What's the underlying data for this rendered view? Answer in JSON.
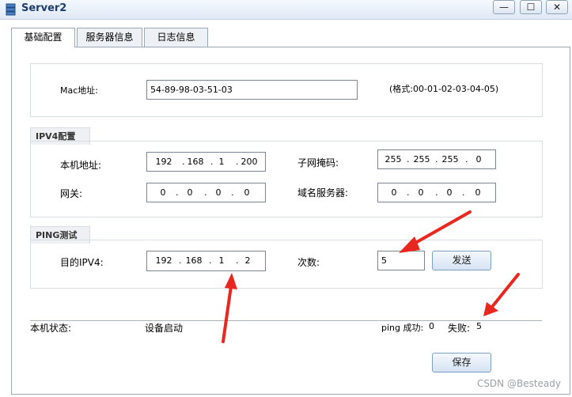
{
  "window": {
    "title": "Server2",
    "min_glyph": "—",
    "max_glyph": "☐",
    "close_glyph": "✕"
  },
  "tabs": [
    {
      "label": "基础配置"
    },
    {
      "label": "服务器信息"
    },
    {
      "label": "日志信息"
    }
  ],
  "mac": {
    "label": "Mac地址:",
    "value": "54-89-98-03-51-03",
    "format_hint": "(格式:00-01-02-03-04-05)"
  },
  "ipv4": {
    "title": "IPV4配置",
    "local_ip_label": "本机地址:",
    "local_ip": [
      "192",
      "168",
      "1",
      "200"
    ],
    "subnet_label": "子网掩码:",
    "subnet": [
      "255",
      "255",
      "255",
      "0"
    ],
    "gateway_label": "网关:",
    "gateway": [
      "0",
      "0",
      "0",
      "0"
    ],
    "dns_label": "域名服务器:",
    "dns": [
      "0",
      "0",
      "0",
      "0"
    ]
  },
  "ping": {
    "title": "PING测试",
    "target_label": "目的IPV4:",
    "target": [
      "192",
      "168",
      "1",
      "2"
    ],
    "count_label": "次数:",
    "count_value": "5",
    "send_label": "发送"
  },
  "status": {
    "label": "本机状态:",
    "value": "设备启动",
    "ping_success_label": "ping 成功:",
    "ping_success": "0",
    "fail_label": "失败:",
    "fail": "5"
  },
  "save_label": "保存",
  "watermark": "CSDN @Besteady",
  "colors": {
    "arrow": "#e8271f",
    "title_text": "#1c3d6e"
  }
}
